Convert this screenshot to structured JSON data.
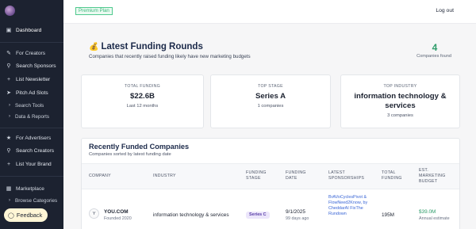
{
  "topbar": {
    "plan_badge": "Premium Plan",
    "logout": "Log out"
  },
  "sidebar": {
    "dashboard": "Dashboard",
    "for_creators": "For Creators",
    "search_sponsors": "Search Sponsors",
    "list_newsletter": "List Newsletter",
    "pitch_ad_slots": "Pitch Ad Slots",
    "search_tools": "Search Tools",
    "data_reports": "Data & Reports",
    "for_advertisers": "For Advertisers",
    "search_creators": "Search Creators",
    "list_your_brand": "List Your Brand",
    "marketplace": "Marketplace",
    "browse_categories": "Browse Categories",
    "feedback": "Feedback"
  },
  "header": {
    "title": "Latest Funding Rounds",
    "subtitle": "Companies that recently raised funding likely have new marketing budgets",
    "count": "4",
    "count_label": "Companies found"
  },
  "stats": [
    {
      "label": "TOTAL FUNDING",
      "value": "$22.6B",
      "sub": "Last 12 months"
    },
    {
      "label": "TOP STAGE",
      "value": "Series A",
      "sub": "1 companies"
    },
    {
      "label": "TOP INDUSTRY",
      "value": "information technology & services",
      "sub": "3 companies"
    }
  ],
  "table": {
    "title": "Recently Funded Companies",
    "subtitle": "Companies sorted by latest funding date",
    "headers": {
      "company": "COMPANY",
      "industry": "INDUSTRY",
      "funding_stage": "FUNDING STAGE",
      "funding_date": "FUNDING DATE",
      "latest_sponsorships": "LATEST SPONSORSHIPS",
      "total_funding": "TOTAL FUNDING",
      "est_marketing_budget": "EST. MARKETING BUDGET"
    },
    "rows": [
      {
        "logo": "Y",
        "company": "YOU.COM",
        "founded": "Founded 2020",
        "industry": "information technology & services",
        "stage": "Series C",
        "date": "9/1/2025",
        "days_ago": "99 days ago",
        "sponsorships": "BrAVoCyclesPivot & FlowNeed2Know, by CheddarAI FixThe Rundown",
        "total_funding": "195M",
        "budget": "$39.0M",
        "budget_note": "Annual estimate"
      }
    ]
  }
}
